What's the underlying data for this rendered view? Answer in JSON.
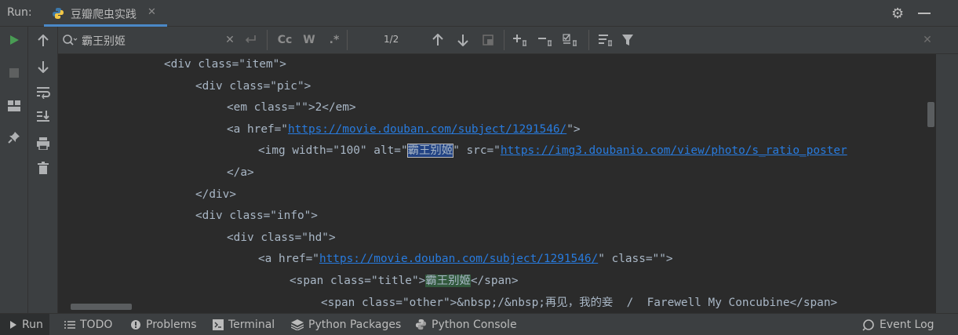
{
  "run_label": "Run:",
  "tab": {
    "title": "豆瓣爬虫实践"
  },
  "search": {
    "query": "霸王别姬",
    "match_count": "1/2",
    "case_label": "Cc",
    "word_label": "W",
    "regex_label": ".*"
  },
  "code_lines": [
    {
      "indent": 3,
      "parts": [
        {
          "t": "<div class=\"item\">"
        }
      ]
    },
    {
      "indent": 4,
      "parts": [
        {
          "t": "<div class=\"pic\">"
        }
      ]
    },
    {
      "indent": 5,
      "parts": [
        {
          "t": "<em class=\"\">2</em>"
        }
      ]
    },
    {
      "indent": 5,
      "parts": [
        {
          "t": "<a href=\""
        },
        {
          "t": "https://movie.douban.com/subject/1291546/",
          "c": "lnk"
        },
        {
          "t": "\">"
        }
      ]
    },
    {
      "indent": 6,
      "parts": [
        {
          "t": "<img width=\"100\" alt=\""
        },
        {
          "t": "霸王别姬",
          "c": "hl-sel"
        },
        {
          "t": "\" src=\""
        },
        {
          "t": "https://img3.doubanio.com/view/photo/s_ratio_poster",
          "c": "lnk"
        }
      ]
    },
    {
      "indent": 5,
      "parts": [
        {
          "t": "</a>"
        }
      ]
    },
    {
      "indent": 4,
      "parts": [
        {
          "t": "</div>"
        }
      ]
    },
    {
      "indent": 4,
      "parts": [
        {
          "t": "<div class=\"info\">"
        }
      ]
    },
    {
      "indent": 5,
      "parts": [
        {
          "t": "<div class=\"hd\">"
        }
      ]
    },
    {
      "indent": 6,
      "parts": [
        {
          "t": "<a href=\""
        },
        {
          "t": "https://movie.douban.com/subject/1291546/",
          "c": "lnk"
        },
        {
          "t": "\" class=\"\">"
        }
      ]
    },
    {
      "indent": 7,
      "parts": [
        {
          "t": "<span class=\"title\">"
        },
        {
          "t": "霸王别姬",
          "c": "hl-find"
        },
        {
          "t": "</span>"
        }
      ]
    },
    {
      "indent": 8,
      "parts": [
        {
          "t": "<span class=\"other\">&nbsp;/&nbsp;再见，我的妾  /  Farewell My Concubine</span>"
        }
      ]
    }
  ],
  "bottom_bar": [
    {
      "label": "Run",
      "icon": "play-icon"
    },
    {
      "label": "TODO",
      "icon": "list-icon"
    },
    {
      "label": "Problems",
      "icon": "info-icon"
    },
    {
      "label": "Terminal",
      "icon": "terminal-icon"
    },
    {
      "label": "Python Packages",
      "icon": "layers-icon"
    },
    {
      "label": "Python Console",
      "icon": "python-icon"
    },
    {
      "label": "Event Log",
      "icon": "event-log-icon"
    }
  ],
  "colors": {
    "accent": "#4a88c7",
    "run_green": "#499c54",
    "link": "#287bde",
    "bg": "#2b2b2b",
    "panel": "#3c3f41"
  }
}
